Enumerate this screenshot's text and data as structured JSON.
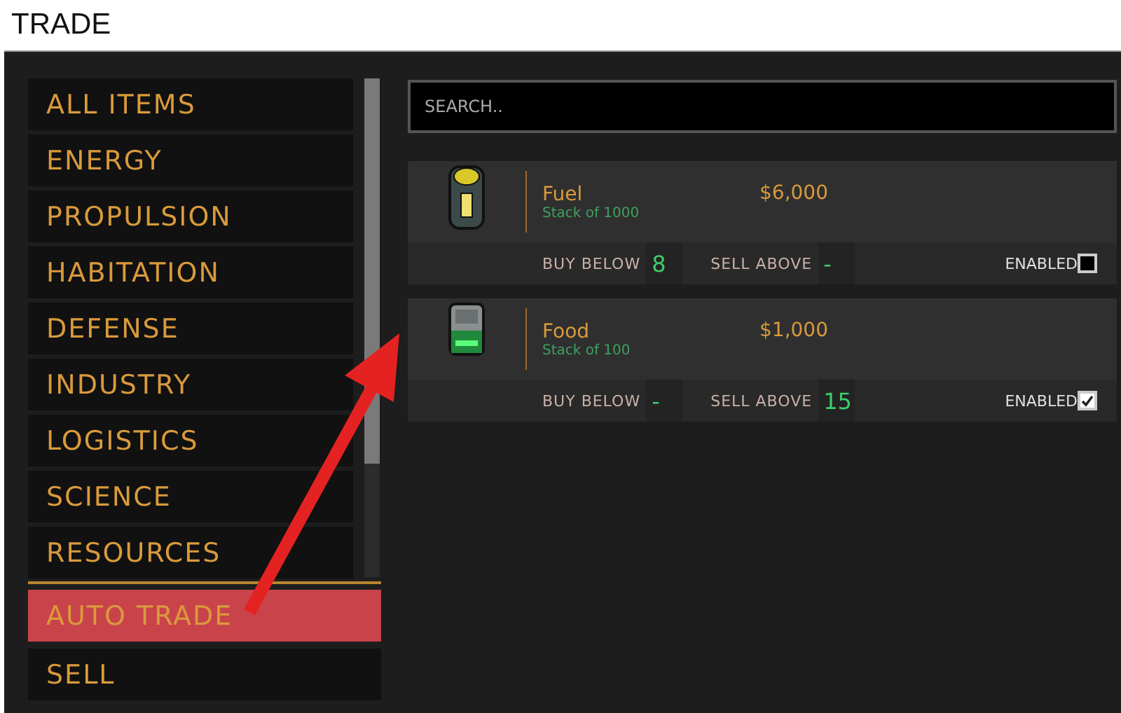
{
  "window": {
    "title": "TRADE"
  },
  "categories": [
    {
      "label": "ALL ITEMS",
      "selected": false
    },
    {
      "label": "ENERGY",
      "selected": false
    },
    {
      "label": "PROPULSION",
      "selected": false
    },
    {
      "label": "HABITATION",
      "selected": false
    },
    {
      "label": "DEFENSE",
      "selected": false
    },
    {
      "label": "INDUSTRY",
      "selected": false
    },
    {
      "label": "LOGISTICS",
      "selected": false
    },
    {
      "label": "SCIENCE",
      "selected": false
    },
    {
      "label": "RESOURCES",
      "selected": false
    }
  ],
  "modes": [
    {
      "label": "AUTO TRADE",
      "selected": true
    },
    {
      "label": "SELL",
      "selected": false
    }
  ],
  "search": {
    "placeholder": "SEARCH.."
  },
  "items": [
    {
      "kind": "fuel",
      "name": "Fuel",
      "stack": "Stack of 1000",
      "price": "$6,000",
      "buy_label": "BUY BELOW",
      "buy_value": "8",
      "sell_label": "SELL ABOVE",
      "sell_value": "-",
      "enabled_label": "ENABLED",
      "enabled": false
    },
    {
      "kind": "food",
      "name": "Food",
      "stack": "Stack of 100",
      "price": "$1,000",
      "buy_label": "BUY BELOW",
      "buy_value": "-",
      "sell_label": "SELL ABOVE",
      "sell_value": "15",
      "enabled_label": "ENABLED",
      "enabled": true
    }
  ]
}
